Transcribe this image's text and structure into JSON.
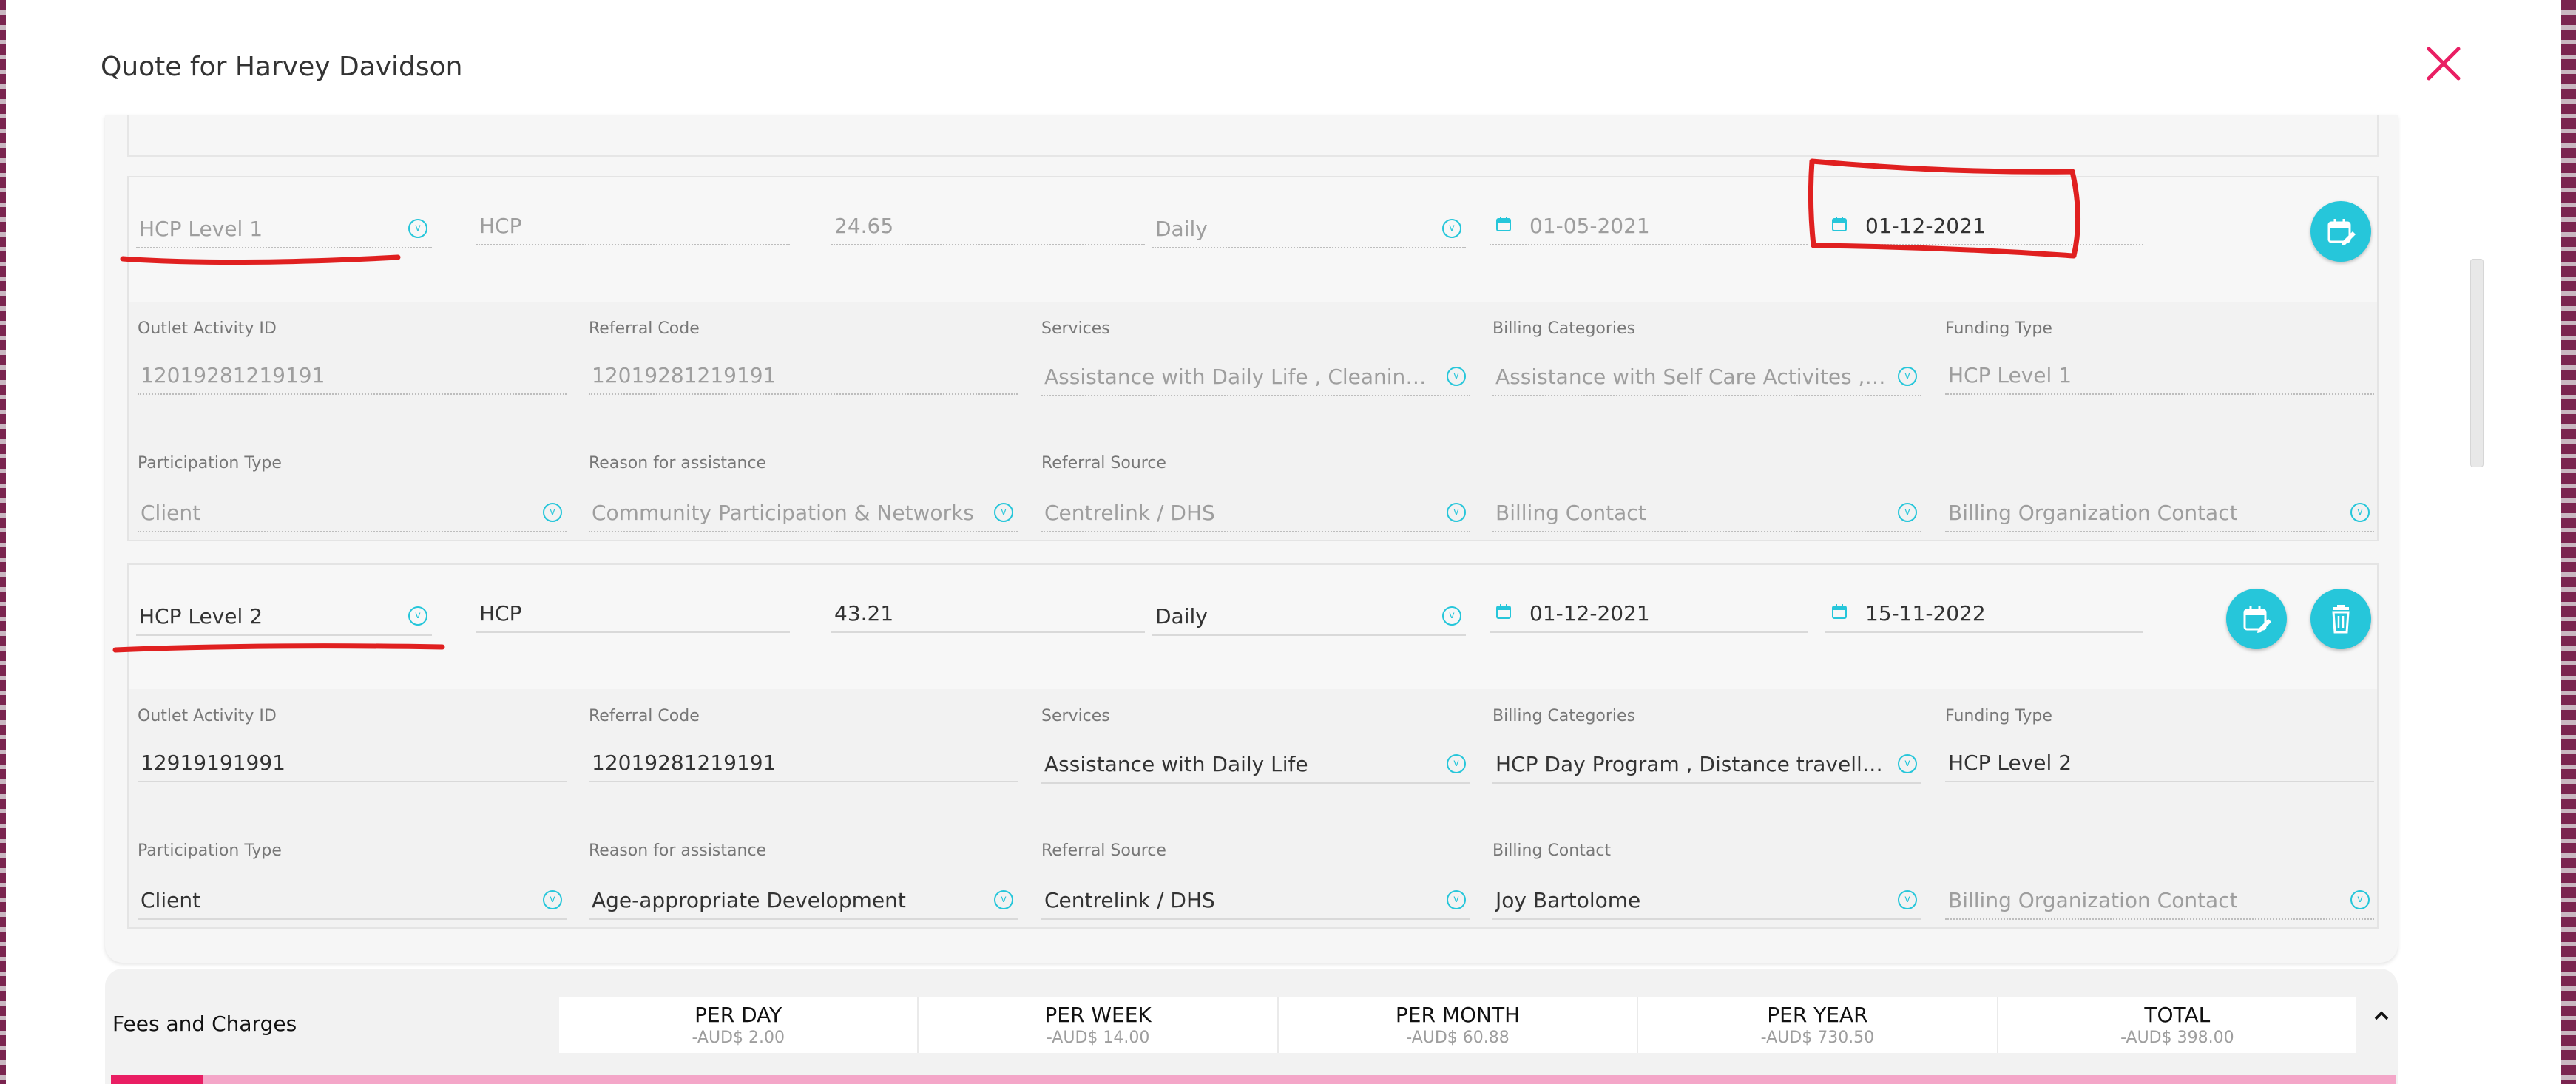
{
  "modal": {
    "title": "Quote for Harvey Davidson"
  },
  "items": [
    {
      "funding": "HCP Level 1",
      "program": "HCP",
      "rate": "24.65",
      "frequency": "Daily",
      "start_date": "01-05-2021",
      "end_date": "01-12-2021",
      "labels": {
        "outlet": "Outlet Activity ID",
        "referral_code": "Referral Code",
        "services": "Services",
        "billing_categories": "Billing Categories",
        "funding_type": "Funding Type",
        "participation_type": "Participation Type",
        "reason": "Reason for assistance",
        "referral_source": "Referral Source"
      },
      "outlet_activity_id": "12019281219191",
      "referral_code": "12019281219191",
      "services": "Assistance with Daily Life , Cleaning Services",
      "billing_categories": "Assistance with Self Care Activites , HCP Day Program",
      "funding_type": "HCP Level 1",
      "participation_type": "Client",
      "reason": "Community Participation & Networks",
      "referral_source": "Centrelink / DHS",
      "billing_contact_placeholder": "Billing Contact",
      "billing_org_placeholder": "Billing Organization Contact"
    },
    {
      "funding": "HCP Level 2",
      "program": "HCP",
      "rate": "43.21",
      "frequency": "Daily",
      "start_date": "01-12-2021",
      "end_date": "15-11-2022",
      "labels": {
        "outlet": "Outlet Activity ID",
        "referral_code": "Referral Code",
        "services": "Services",
        "billing_categories": "Billing Categories",
        "funding_type": "Funding Type",
        "participation_type": "Participation Type",
        "reason": "Reason for assistance",
        "referral_source": "Referral Source",
        "billing_contact": "Billing Contact"
      },
      "outlet_activity_id": "12919191991",
      "referral_code": "12019281219191",
      "services": "Assistance with Daily Life",
      "billing_categories": "HCP Day Program , Distance travelled with client",
      "funding_type": "HCP Level 2",
      "participation_type": "Client",
      "reason": "Age-appropriate Development",
      "referral_source": "Centrelink / DHS",
      "billing_contact": "Joy Bartolome",
      "billing_org_placeholder": "Billing Organization Contact"
    }
  ],
  "fees": {
    "title": "Fees and Charges",
    "columns": [
      {
        "label": "PER DAY",
        "value": "-AUD$ 2.00"
      },
      {
        "label": "PER WEEK",
        "value": "-AUD$ 14.00"
      },
      {
        "label": "PER MONTH",
        "value": "-AUD$ 60.88"
      },
      {
        "label": "PER YEAR",
        "value": "-AUD$ 730.50"
      },
      {
        "label": "TOTAL",
        "value": "-AUD$ 398.00"
      }
    ],
    "progress_fraction": 0.04
  },
  "colors": {
    "accent": "#26c6da",
    "close": "#e91e63",
    "annotation": "#e02020"
  },
  "icons": {
    "dropdown": "v",
    "calendar": "calendar-icon",
    "edit": "calendar-edit-icon",
    "delete": "trash-icon",
    "close": "close-icon",
    "caret": "chevron-up-icon"
  }
}
